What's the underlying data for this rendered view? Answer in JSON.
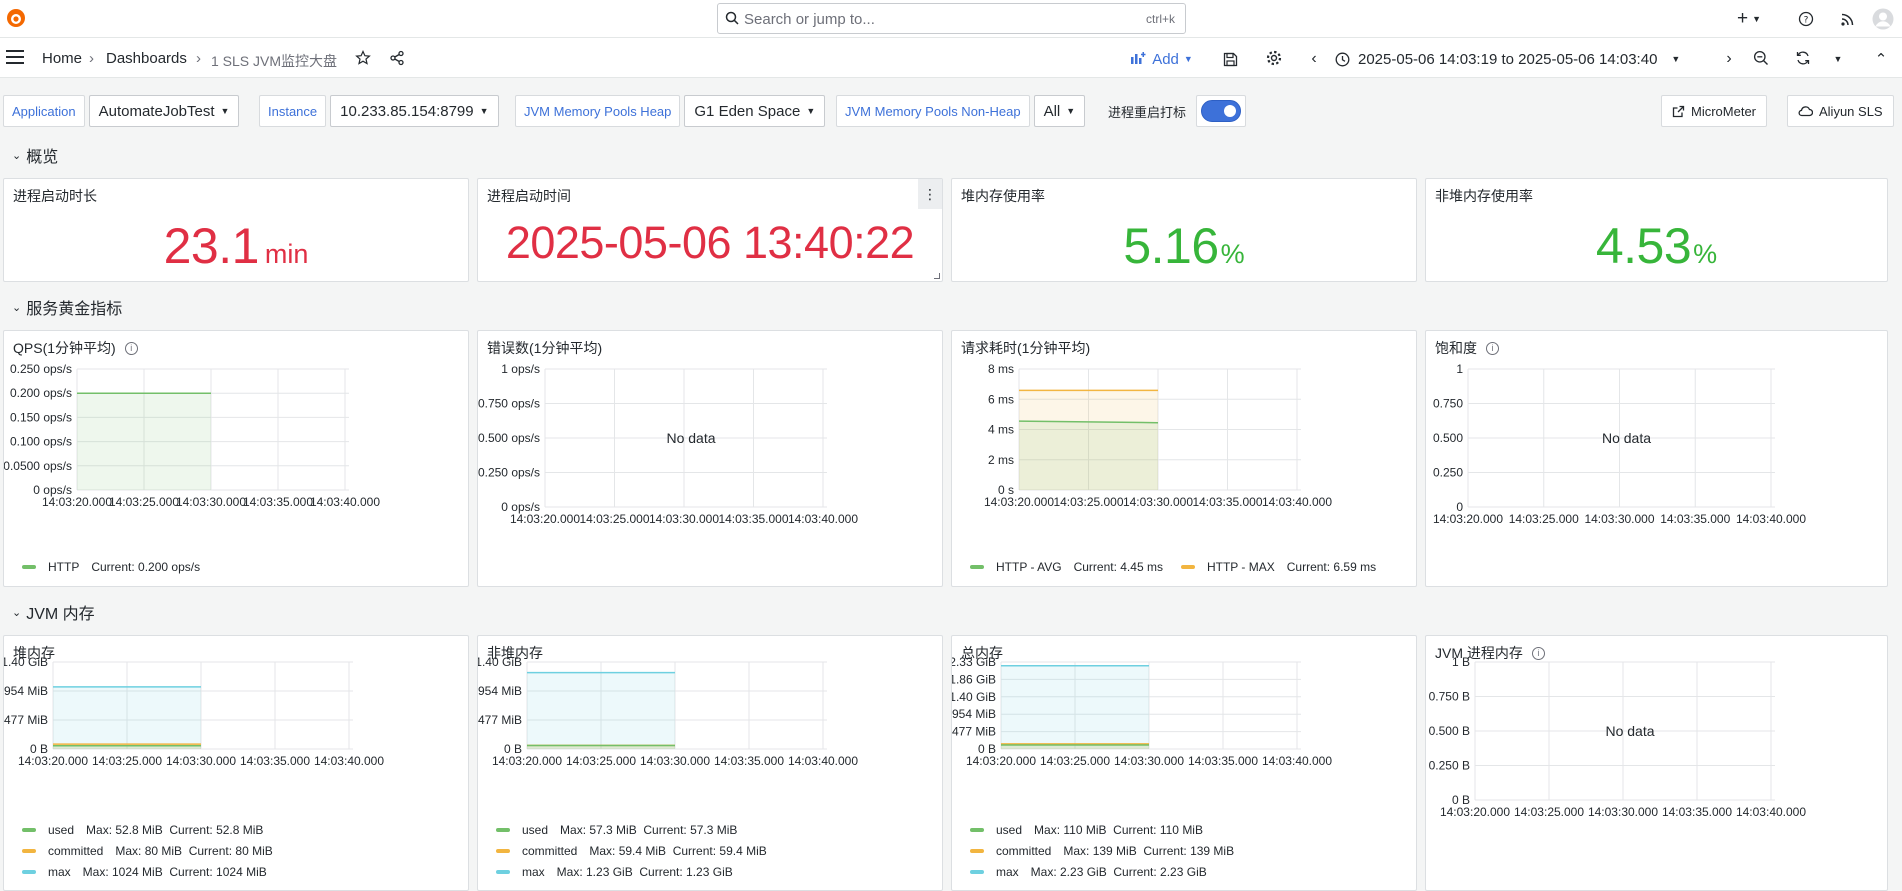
{
  "header": {
    "search_placeholder": "Search or jump to...",
    "search_shortcut": "ctrl+k",
    "plus_label": "+"
  },
  "nav": {
    "breadcrumb": [
      "Home",
      "Dashboards",
      "1 SLS JVM监控大盘"
    ],
    "add_label": "Add",
    "time_range": "2025-05-06 14:03:19 to 2025-05-06 14:03:40"
  },
  "variables": {
    "application_label": "Application",
    "application_value": "AutomateJobTest",
    "instance_label": "Instance",
    "instance_value": "10.233.85.154:8799",
    "heap_label": "JVM Memory Pools Heap",
    "heap_value": "G1 Eden Space",
    "nonheap_label": "JVM Memory Pools Non-Heap",
    "nonheap_value": "All",
    "restart_label": "进程重启打标",
    "micrometer_label": "MicroMeter",
    "aliyun_label": "Aliyun SLS"
  },
  "rows": {
    "overview": "概览",
    "golden": "服务黄金指标",
    "jvm_memory": "JVM 内存"
  },
  "stats": [
    {
      "title": "进程启动时长",
      "value": "23.1",
      "unit": "min",
      "color": "#e02f44"
    },
    {
      "title": "进程启动时间",
      "value": "2025-05-06 13:40:22",
      "unit": "",
      "color": "#e02f44"
    },
    {
      "title": "堆内存使用率",
      "value": "5.16",
      "unit": "%",
      "color": "#37b53a"
    },
    {
      "title": "非堆内存使用率",
      "value": "4.53",
      "unit": "%",
      "color": "#37b53a"
    }
  ],
  "colors": {
    "green": "#73bf69",
    "yellow": "#fade2a",
    "orange": "#f2b540",
    "cyan": "#6ed0e0",
    "accent": "#3d71d9",
    "red": "#e02f44",
    "stat_green": "#37b53a"
  },
  "no_data_text": "No data",
  "xticks": [
    "14:03:20.000",
    "14:03:25.000",
    "14:03:30.000",
    "14:03:35.000",
    "14:03:40.000"
  ],
  "panels": {
    "qps": {
      "title": "QPS(1分钟平均)",
      "legend": [
        {
          "name": "HTTP",
          "current": "Current: 0.200 ops/s"
        }
      ]
    },
    "errors": {
      "title": "错误数(1分钟平均)"
    },
    "latency": {
      "title": "请求耗时(1分钟平均)",
      "legend": [
        {
          "name": "HTTP - AVG",
          "current": "Current: 4.45 ms"
        },
        {
          "name": "HTTP - MAX",
          "current": "Current: 6.59 ms"
        }
      ]
    },
    "saturation": {
      "title": "饱和度"
    },
    "heap": {
      "title": "堆内存",
      "legend": [
        {
          "name": "used",
          "stats": "Max: 52.8 MiB  Current: 52.8 MiB"
        },
        {
          "name": "committed",
          "stats": "Max: 80 MiB  Current: 80 MiB"
        },
        {
          "name": "max",
          "stats": "Max: 1024 MiB  Current: 1024 MiB"
        }
      ]
    },
    "nonheap": {
      "title": "非堆内存",
      "legend": [
        {
          "name": "used",
          "stats": "Max: 57.3 MiB  Current: 57.3 MiB"
        },
        {
          "name": "committed",
          "stats": "Max: 59.4 MiB  Current: 59.4 MiB"
        },
        {
          "name": "max",
          "stats": "Max: 1.23 GiB  Current: 1.23 GiB"
        }
      ]
    },
    "total": {
      "title": "总内存",
      "legend": [
        {
          "name": "used",
          "stats": "Max: 110 MiB  Current: 110 MiB"
        },
        {
          "name": "committed",
          "stats": "Max: 139 MiB  Current: 139 MiB"
        },
        {
          "name": "max",
          "stats": "Max: 2.23 GiB  Current: 2.23 GiB"
        }
      ]
    },
    "process": {
      "title": "JVM 进程内存"
    }
  },
  "chart_data": [
    {
      "id": "qps",
      "type": "area",
      "yticks": [
        "0.250 ops/s",
        "0.200 ops/s",
        "0.150 ops/s",
        "0.100 ops/s",
        "0.0500 ops/s",
        "0 ops/s"
      ],
      "ylim": [
        0,
        0.25
      ],
      "series": [
        {
          "name": "HTTP",
          "color": "#73bf69",
          "x": [
            "14:03:20",
            "14:03:30"
          ],
          "values": [
            0.2,
            0.2
          ]
        }
      ]
    },
    {
      "id": "errors",
      "type": "line",
      "yticks": [
        "1 ops/s",
        "0.750 ops/s",
        "0.500 ops/s",
        "0.250 ops/s",
        "0 ops/s"
      ],
      "ylim": [
        0,
        1
      ],
      "series": []
    },
    {
      "id": "latency",
      "type": "area",
      "yticks": [
        "8 ms",
        "6 ms",
        "4 ms",
        "2 ms",
        "0 s"
      ],
      "ylim": [
        0,
        8
      ],
      "series": [
        {
          "name": "HTTP - AVG",
          "color": "#73bf69",
          "x": [
            "14:03:20",
            "14:03:30"
          ],
          "values": [
            4.55,
            4.45
          ]
        },
        {
          "name": "HTTP - MAX",
          "color": "#f2b540",
          "x": [
            "14:03:20",
            "14:03:30"
          ],
          "values": [
            6.59,
            6.59
          ]
        }
      ]
    },
    {
      "id": "saturation",
      "type": "line",
      "yticks": [
        "1",
        "0.750",
        "0.500",
        "0.250",
        "0"
      ],
      "ylim": [
        0,
        1
      ],
      "series": []
    },
    {
      "id": "heap",
      "type": "area",
      "yticks": [
        "1.40 GiB",
        "954 MiB",
        "477 MiB",
        "0 B"
      ],
      "ylim": [
        0,
        1.4
      ],
      "series": [
        {
          "name": "used",
          "color": "#73bf69",
          "x": [
            "14:03:20",
            "14:03:30"
          ],
          "values": [
            0.0516,
            0.0516
          ]
        },
        {
          "name": "committed",
          "color": "#f2b540",
          "x": [
            "14:03:20",
            "14:03:30"
          ],
          "values": [
            0.078,
            0.078
          ]
        },
        {
          "name": "max",
          "color": "#6ed0e0",
          "x": [
            "14:03:20",
            "14:03:30"
          ],
          "values": [
            1.0,
            1.0
          ]
        }
      ]
    },
    {
      "id": "nonheap",
      "type": "area",
      "yticks": [
        "1.40 GiB",
        "954 MiB",
        "477 MiB",
        "0 B"
      ],
      "ylim": [
        0,
        1.4
      ],
      "series": [
        {
          "name": "used",
          "color": "#73bf69",
          "x": [
            "14:03:20",
            "14:03:30"
          ],
          "values": [
            0.056,
            0.056
          ]
        },
        {
          "name": "committed",
          "color": "#f2b540",
          "x": [
            "14:03:20",
            "14:03:30"
          ],
          "values": [
            0.058,
            0.058
          ]
        },
        {
          "name": "max",
          "color": "#6ed0e0",
          "x": [
            "14:03:20",
            "14:03:30"
          ],
          "values": [
            1.23,
            1.23
          ]
        }
      ]
    },
    {
      "id": "total",
      "type": "area",
      "yticks": [
        "2.33 GiB",
        "1.86 GiB",
        "1.40 GiB",
        "954 MiB",
        "477 MiB",
        "0 B"
      ],
      "ylim": [
        0,
        2.33
      ],
      "series": [
        {
          "name": "used",
          "color": "#73bf69",
          "x": [
            "14:03:20",
            "14:03:30"
          ],
          "values": [
            0.107,
            0.107
          ]
        },
        {
          "name": "committed",
          "color": "#f2b540",
          "x": [
            "14:03:20",
            "14:03:30"
          ],
          "values": [
            0.136,
            0.136
          ]
        },
        {
          "name": "max",
          "color": "#6ed0e0",
          "x": [
            "14:03:20",
            "14:03:30"
          ],
          "values": [
            2.23,
            2.23
          ]
        }
      ]
    },
    {
      "id": "process",
      "type": "line",
      "yticks": [
        "1 B",
        "0.750 B",
        "0.500 B",
        "0.250 B",
        "0 B"
      ],
      "ylim": [
        0,
        1
      ],
      "series": []
    }
  ]
}
